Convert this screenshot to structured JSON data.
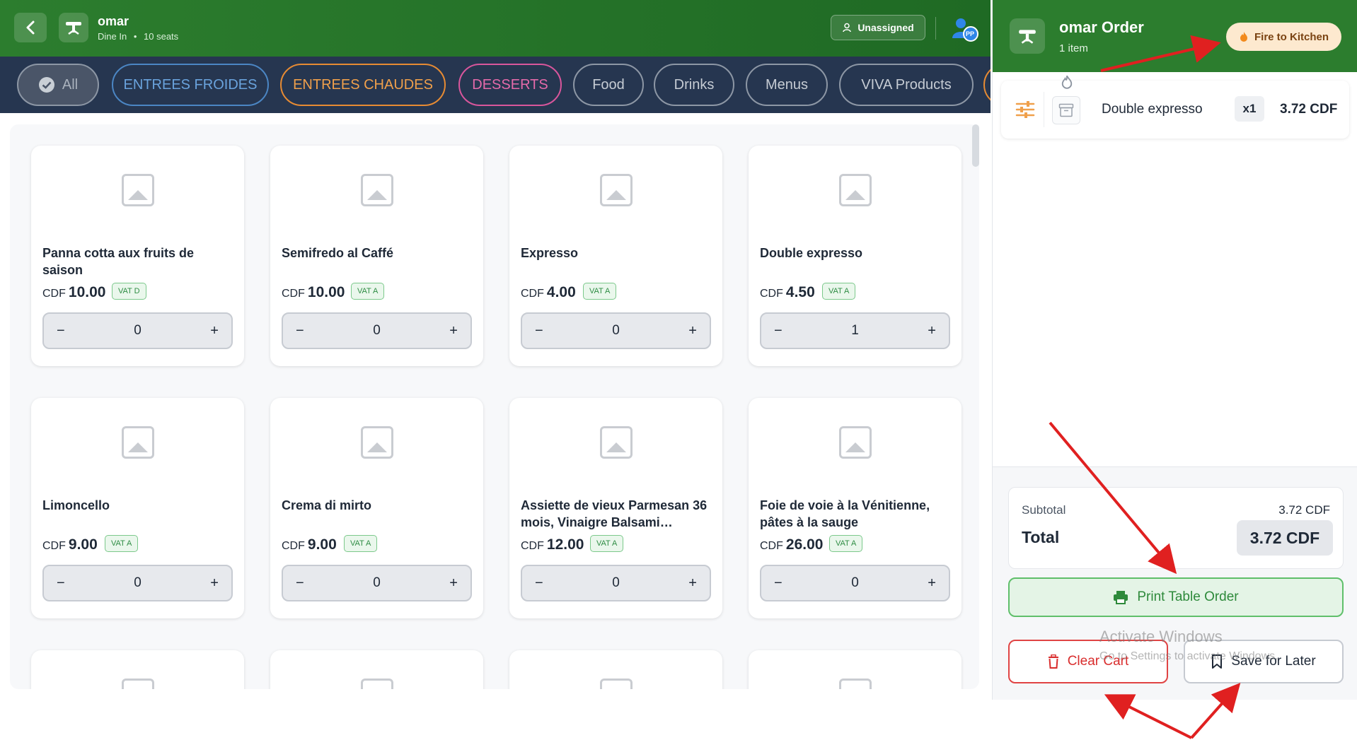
{
  "header": {
    "table_name": "omar",
    "service_mode": "Dine In",
    "separator": "•",
    "seats": "10 seats",
    "assign_label": "Unassigned",
    "avatar_initials": "PP"
  },
  "categories": [
    {
      "label": "All",
      "selected": true,
      "color": "#aab2bd"
    },
    {
      "label": "ENTREES FROIDES",
      "color": "#4b86c4"
    },
    {
      "label": "ENTREES CHAUDES",
      "color": "#e78b33"
    },
    {
      "label": "DESSERTS",
      "color": "#d9569c"
    },
    {
      "label": "Food",
      "color": "#aab2bd"
    },
    {
      "label": "Drinks",
      "color": "#aab2bd"
    },
    {
      "label": "Menus",
      "color": "#aab2bd"
    },
    {
      "label": "VIVA Products",
      "color": "#aab2bd"
    }
  ],
  "products": [
    {
      "name": "Panna cotta aux fruits de saison",
      "currency": "CDF",
      "price": "10.00",
      "vat": "VAT D",
      "qty": "0"
    },
    {
      "name": "Semifredo al Caffé",
      "currency": "CDF",
      "price": "10.00",
      "vat": "VAT A",
      "qty": "0"
    },
    {
      "name": "Expresso",
      "currency": "CDF",
      "price": "4.00",
      "vat": "VAT A",
      "qty": "0"
    },
    {
      "name": "Double expresso",
      "currency": "CDF",
      "price": "4.50",
      "vat": "VAT A",
      "qty": "1"
    },
    {
      "name": "Limoncello",
      "currency": "CDF",
      "price": "9.00",
      "vat": "VAT A",
      "qty": "0"
    },
    {
      "name": "Crema di mirto",
      "currency": "CDF",
      "price": "9.00",
      "vat": "VAT A",
      "qty": "0"
    },
    {
      "name": "Assiette de vieux Parmesan 36 mois, Vinaigre Balsami…",
      "currency": "CDF",
      "price": "12.00",
      "vat": "VAT A",
      "qty": "0"
    },
    {
      "name": "Foie de voie à la Vénitienne, pâtes à la sauge",
      "currency": "CDF",
      "price": "26.00",
      "vat": "VAT A",
      "qty": "0"
    }
  ],
  "stepper": {
    "minus": "−",
    "plus": "+"
  },
  "order": {
    "title": "omar Order",
    "item_count": "1 item",
    "fire_label": "Fire to Kitchen",
    "items": [
      {
        "name": "Double expresso",
        "qty": "x1",
        "price": "3.72 CDF"
      }
    ],
    "subtotal_label": "Subtotal",
    "subtotal_value": "3.72 CDF",
    "total_label": "Total",
    "total_value": "3.72 CDF",
    "print_label": "Print Table Order",
    "clear_label": "Clear Cart",
    "save_label": "Save for Later"
  },
  "watermark": {
    "line1": "Activate Windows",
    "line2": "Go to Settings to activate Windows."
  },
  "colors": {
    "header_green": "#2c7d2e",
    "category_bar": "#263650",
    "annotation_red": "#e02020"
  }
}
